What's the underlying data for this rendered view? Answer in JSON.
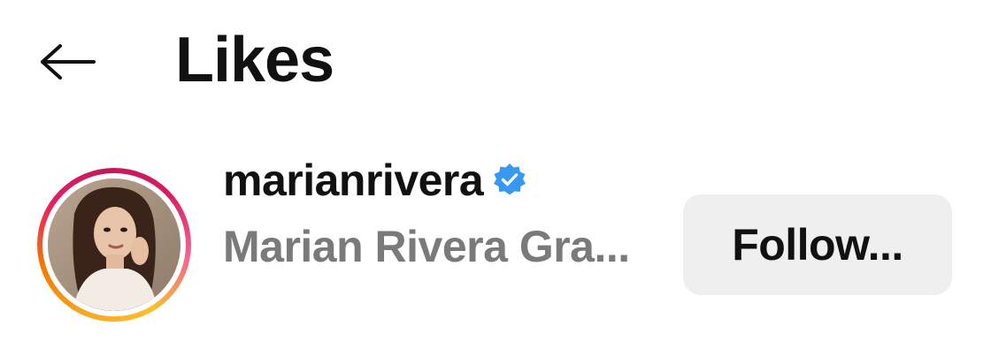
{
  "header": {
    "back_icon": "arrow-left-icon",
    "title": "Likes"
  },
  "likes_list": [
    {
      "username": "marianrivera",
      "verified": true,
      "verified_icon": "verified-badge-icon",
      "full_name": "Marian Rivera Gra...",
      "follow_label": "Follow...",
      "story_ring": true
    }
  ],
  "colors": {
    "verified_blue": "#3897f0",
    "button_bg": "#efefef",
    "secondary_text": "#7a7a7a",
    "story_ring_start": "#f9a825",
    "story_ring_end": "#d81b60"
  }
}
